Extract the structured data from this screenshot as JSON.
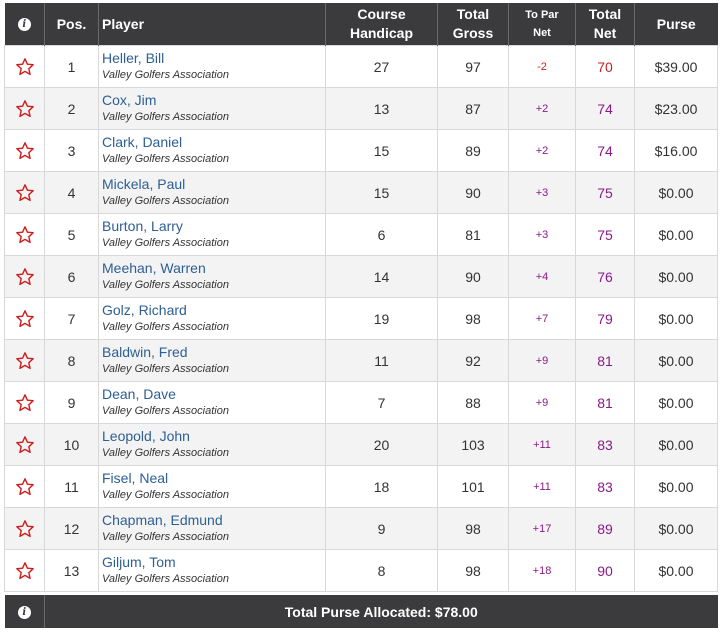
{
  "header": {
    "pos": "Pos.",
    "player": "Player",
    "course_handicap_line1": "Course",
    "course_handicap_line2": "Handicap",
    "total_gross_line1": "Total",
    "total_gross_line2": "Gross",
    "to_par_line1": "To Par",
    "to_par_line2": "Net",
    "total_net_line1": "Total",
    "total_net_line2": "Net",
    "purse": "Purse"
  },
  "rows": [
    {
      "pos": "1",
      "name": "Heller, Bill",
      "assoc": "Valley Golfers Association",
      "handicap": "27",
      "gross": "97",
      "to_par": "-2",
      "net": "70",
      "purse": "$39.00",
      "par_sign": "neg"
    },
    {
      "pos": "2",
      "name": "Cox, Jim",
      "assoc": "Valley Golfers Association",
      "handicap": "13",
      "gross": "87",
      "to_par": "+2",
      "net": "74",
      "purse": "$23.00",
      "par_sign": "pos"
    },
    {
      "pos": "3",
      "name": "Clark, Daniel",
      "assoc": "Valley Golfers Association",
      "handicap": "15",
      "gross": "89",
      "to_par": "+2",
      "net": "74",
      "purse": "$16.00",
      "par_sign": "pos"
    },
    {
      "pos": "4",
      "name": "Mickela, Paul",
      "assoc": "Valley Golfers Association",
      "handicap": "15",
      "gross": "90",
      "to_par": "+3",
      "net": "75",
      "purse": "$0.00",
      "par_sign": "pos"
    },
    {
      "pos": "5",
      "name": "Burton, Larry",
      "assoc": "Valley Golfers Association",
      "handicap": "6",
      "gross": "81",
      "to_par": "+3",
      "net": "75",
      "purse": "$0.00",
      "par_sign": "pos"
    },
    {
      "pos": "6",
      "name": "Meehan, Warren",
      "assoc": "Valley Golfers Association",
      "handicap": "14",
      "gross": "90",
      "to_par": "+4",
      "net": "76",
      "purse": "$0.00",
      "par_sign": "pos"
    },
    {
      "pos": "7",
      "name": "Golz, Richard",
      "assoc": "Valley Golfers Association",
      "handicap": "19",
      "gross": "98",
      "to_par": "+7",
      "net": "79",
      "purse": "$0.00",
      "par_sign": "pos"
    },
    {
      "pos": "8",
      "name": "Baldwin, Fred",
      "assoc": "Valley Golfers Association",
      "handicap": "11",
      "gross": "92",
      "to_par": "+9",
      "net": "81",
      "purse": "$0.00",
      "par_sign": "pos"
    },
    {
      "pos": "9",
      "name": "Dean, Dave",
      "assoc": "Valley Golfers Association",
      "handicap": "7",
      "gross": "88",
      "to_par": "+9",
      "net": "81",
      "purse": "$0.00",
      "par_sign": "pos"
    },
    {
      "pos": "10",
      "name": "Leopold, John",
      "assoc": "Valley Golfers Association",
      "handicap": "20",
      "gross": "103",
      "to_par": "+11",
      "net": "83",
      "purse": "$0.00",
      "par_sign": "pos"
    },
    {
      "pos": "11",
      "name": "Fisel, Neal",
      "assoc": "Valley Golfers Association",
      "handicap": "18",
      "gross": "101",
      "to_par": "+11",
      "net": "83",
      "purse": "$0.00",
      "par_sign": "pos"
    },
    {
      "pos": "12",
      "name": "Chapman, Edmund",
      "assoc": "Valley Golfers Association",
      "handicap": "9",
      "gross": "98",
      "to_par": "+17",
      "net": "89",
      "purse": "$0.00",
      "par_sign": "pos"
    },
    {
      "pos": "13",
      "name": "Giljum, Tom",
      "assoc": "Valley Golfers Association",
      "handicap": "8",
      "gross": "98",
      "to_par": "+18",
      "net": "90",
      "purse": "$0.00",
      "par_sign": "pos"
    }
  ],
  "footer": {
    "total_purse": "Total Purse Allocated: $78.00"
  },
  "icons": {
    "info": "info-icon",
    "favorite": "star-outline-icon"
  },
  "colors": {
    "header_bg": "#3b3b3d",
    "star": "#cc2020",
    "player_link": "#2d5f94",
    "under_par": "#cc2020",
    "over_par": "#8a1a8a"
  }
}
